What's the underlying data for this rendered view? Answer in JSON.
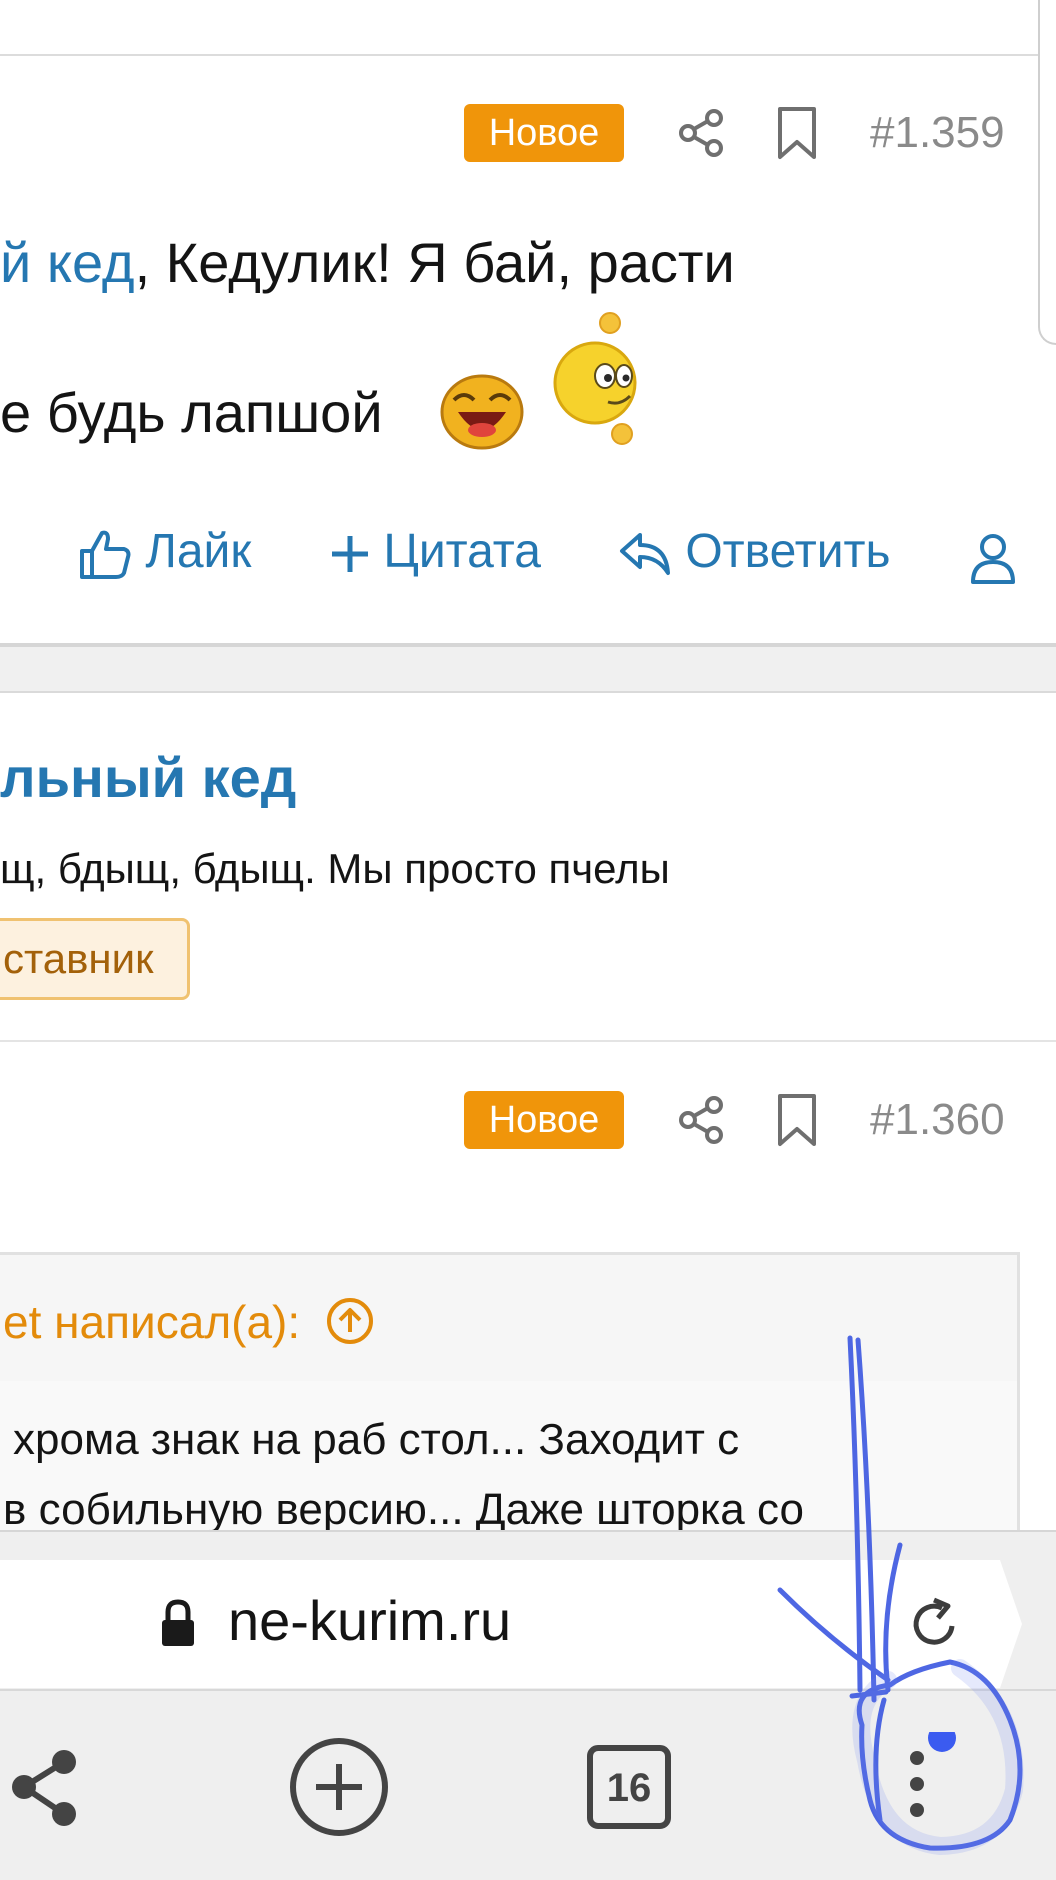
{
  "colors": {
    "accent_link": "#2577b1",
    "badge_new": "#f0950a",
    "quote_title": "#e38b0b",
    "annotation_ink": "#3b57e0",
    "notification_dot": "#3b5bf0"
  },
  "post1": {
    "badge": "Новое",
    "number": "#1.359",
    "text_link": "й кед",
    "text_rest": ", Кедулик! Я бай, расти",
    "text_line2": "е будь лапшой",
    "icons": [
      "share-icon",
      "bookmark-icon",
      "laughing-smiley-icon",
      "winking-smiley-icon"
    ]
  },
  "actions": {
    "like": "Лайк",
    "quote": "Цитата",
    "reply": "Ответить",
    "icons": [
      "thumbs-up-icon",
      "plus-icon",
      "reply-arrow-icon",
      "user-icon"
    ]
  },
  "user": {
    "name": "льный кед",
    "status": "щ, бдыщ, бдыщ. Мы просто пчелы",
    "role": "ставник"
  },
  "post2": {
    "badge": "Новое",
    "number": "#1.360",
    "quote_title": "et написал(а):",
    "quote_line1": "хрома знак на раб стол... Заходит с",
    "quote_line2": "в собильную версию... Даже шторка со"
  },
  "browser": {
    "url": "ne-kurim.ru",
    "tab_count": "16",
    "icons": [
      "lock-icon",
      "reload-icon",
      "share-icon",
      "new-tab-plus-icon",
      "tabs-icon",
      "more-menu-icon"
    ]
  }
}
